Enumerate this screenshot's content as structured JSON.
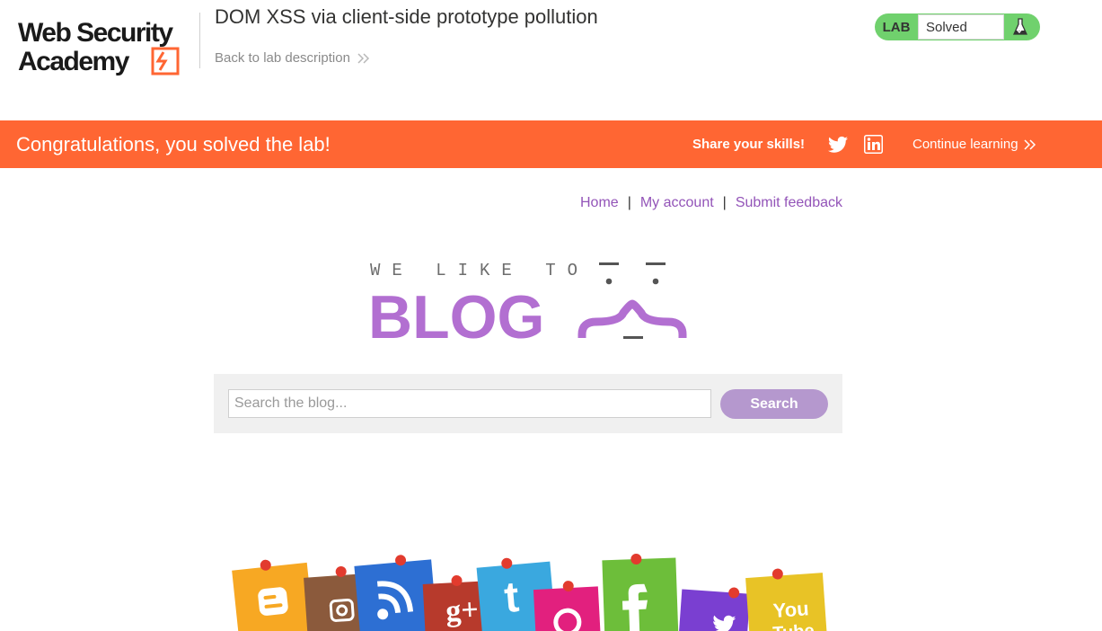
{
  "header": {
    "logo_text_line1": "Web Security",
    "logo_text_line2": "Academy",
    "lab_title": "DOM XSS via client-side prototype pollution",
    "back_link": "Back to lab description",
    "lab_badge": "LAB",
    "lab_status": "Solved"
  },
  "banner": {
    "congrats": "Congratulations, you solved the lab!",
    "share": "Share your skills!",
    "continue": "Continue learning",
    "icons": [
      "twitter-icon",
      "linkedin-icon"
    ]
  },
  "nav": {
    "home": "Home",
    "separator": "|",
    "my_account": "My account",
    "submit_feedback": "Submit feedback"
  },
  "blog": {
    "tagline": "WE LIKE TO",
    "word": "BLOG"
  },
  "search": {
    "placeholder": "Search the blog...",
    "button": "Search"
  },
  "colors": {
    "accent": "#ff6633",
    "solved_green": "#70d16d",
    "link_purple": "#9354b8",
    "search_button": "#b598ce"
  }
}
